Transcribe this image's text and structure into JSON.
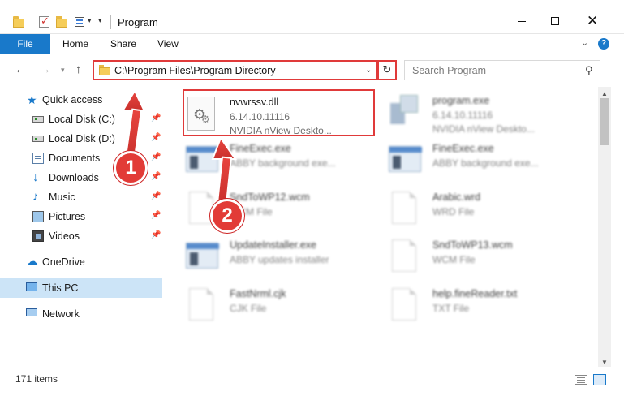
{
  "window": {
    "title": "Program",
    "controls": {
      "minimize": "minimize",
      "maximize": "maximize",
      "close": "✕"
    }
  },
  "ribbon": {
    "tabs": [
      {
        "label": "File"
      },
      {
        "label": "Home"
      },
      {
        "label": "Share"
      },
      {
        "label": "View"
      }
    ],
    "help": "?"
  },
  "nav": {
    "address": "C:\\Program Files\\Program Directory",
    "search_placeholder": "Search Program"
  },
  "sidebar": {
    "items": [
      {
        "label": "Quick access",
        "icon": "star-icon"
      },
      {
        "label": "Local Disk (C:)",
        "icon": "drive-icon",
        "pinned": true
      },
      {
        "label": "Local Disk (D:)",
        "icon": "drive-icon",
        "pinned": true
      },
      {
        "label": "Documents",
        "icon": "documents-icon",
        "pinned": true
      },
      {
        "label": "Downloads",
        "icon": "download-icon",
        "pinned": true
      },
      {
        "label": "Music",
        "icon": "music-icon",
        "pinned": true
      },
      {
        "label": "Pictures",
        "icon": "pictures-icon",
        "pinned": true
      },
      {
        "label": "Videos",
        "icon": "videos-icon",
        "pinned": true
      },
      {
        "label": "OneDrive",
        "icon": "cloud-icon"
      },
      {
        "label": "This PC",
        "icon": "computer-icon",
        "selected": true
      },
      {
        "label": "Network",
        "icon": "network-icon"
      }
    ]
  },
  "files": [
    {
      "name": "nvwrssv.dll",
      "meta1": "6.14.10.11116",
      "meta2": "NVIDIA nView Deskto...",
      "type": "dll",
      "highlighted": true
    },
    {
      "name": "program.exe",
      "meta1": "6.14.10.11116",
      "meta2": "NVIDIA nView Deskto...",
      "type": "prog"
    },
    {
      "name": "FineExec.exe",
      "meta1": "ABBY background exe...",
      "meta2": "",
      "type": "exe"
    },
    {
      "name": "FineExec.exe",
      "meta1": "ABBY background exe...",
      "meta2": "",
      "type": "exe"
    },
    {
      "name": "SndToWP12.wcm",
      "meta1": "WCM File",
      "meta2": "",
      "type": "doc"
    },
    {
      "name": "Arabic.wrd",
      "meta1": "WRD File",
      "meta2": "",
      "type": "doc"
    },
    {
      "name": "UpdateInstaller.exe",
      "meta1": "ABBY updates installer",
      "meta2": "",
      "type": "exe"
    },
    {
      "name": "SndToWP13.wcm",
      "meta1": "WCM File",
      "meta2": "",
      "type": "doc"
    },
    {
      "name": "FastNrml.cjk",
      "meta1": "CJK File",
      "meta2": "",
      "type": "doc"
    },
    {
      "name": "help.fineReader.txt",
      "meta1": "TXT File",
      "meta2": "",
      "type": "doc"
    }
  ],
  "status": {
    "item_count": "171 items"
  },
  "annotations": {
    "step1": "1",
    "step2": "2",
    "accent": "#e23b37"
  }
}
